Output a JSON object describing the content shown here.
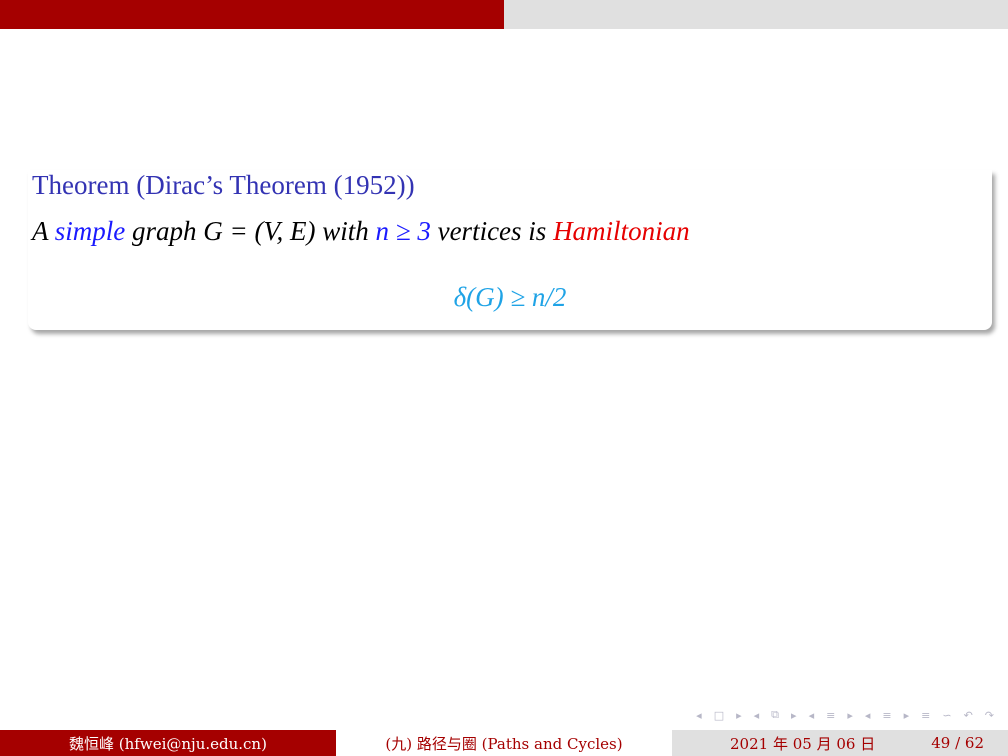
{
  "progress": {
    "fraction": 0.5
  },
  "theorem": {
    "title": "Theorem (Dirac’s Theorem (1952))",
    "statement": {
      "p1": "A ",
      "simple": "simple",
      "p2": " graph ",
      "math1": "G = (V, E)",
      "p3": " with ",
      "n_ge_3": "n ≥ 3",
      "p4": " vertices is ",
      "hamiltonian": "Hamiltonian"
    },
    "condition": "δ(G) ≥ n/2"
  },
  "nav": {
    "slide_prev": "◂",
    "slide_icon": "□",
    "slide_next": "▸",
    "frame_prev": "◂",
    "frame_icon": "⧉",
    "frame_next": "▸",
    "sub_prev": "◂",
    "sub_icon": "≡",
    "sub_next": "▸",
    "sec_prev": "◂",
    "sec_icon": "≡",
    "sec_next": "▸",
    "align_icon": "≡",
    "search_icon": "∽",
    "back_icon": "↶",
    "fwd_icon": "↷"
  },
  "footer": {
    "author": "魏恒峰 (hfwei@nju.edu.cn)",
    "title": "(九) 路径与圈 (Paths and Cycles)",
    "date": "2021 年 05 月 06 日",
    "page": "49 / 62"
  },
  "colors": {
    "brand": "#a50000",
    "block_title": "#3333b3",
    "alert_red": "#e60000",
    "highlight_blue": "#1a1aff",
    "condition_cyan": "#1fa3e6"
  }
}
